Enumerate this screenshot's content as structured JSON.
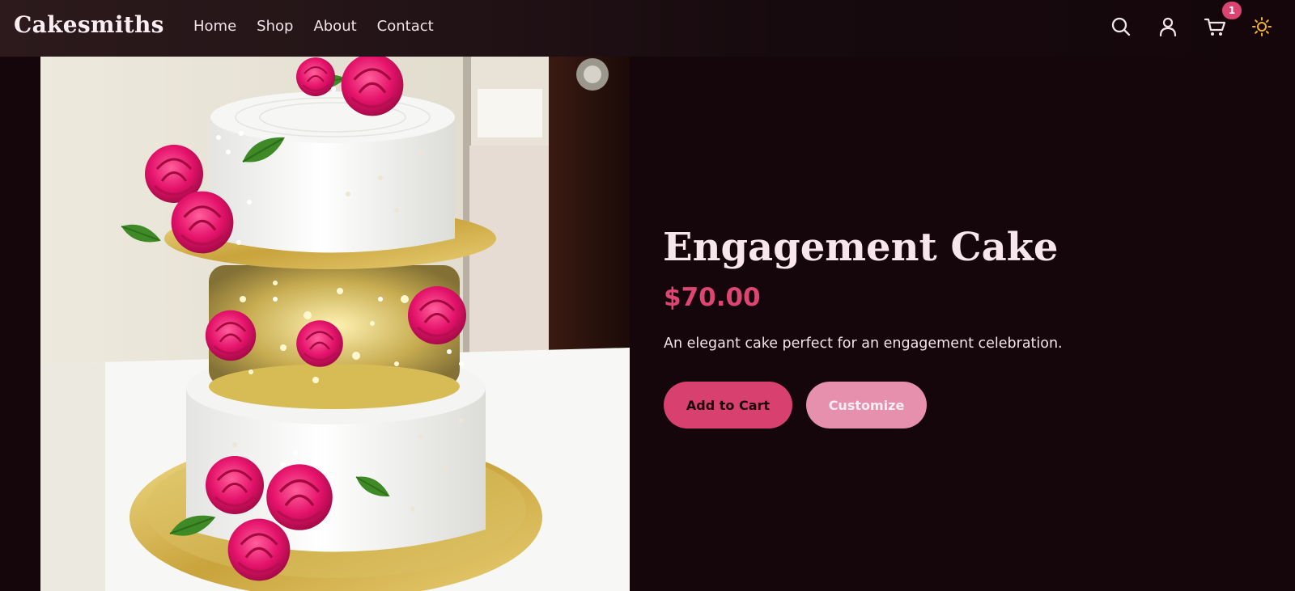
{
  "header": {
    "logo": "Cakesmiths",
    "nav": [
      {
        "label": "Home"
      },
      {
        "label": "Shop"
      },
      {
        "label": "About"
      },
      {
        "label": "Contact"
      }
    ],
    "icons": [
      "search-icon",
      "user-icon",
      "cart-icon",
      "sun-icon"
    ],
    "cart_count": "1"
  },
  "product": {
    "image_subject": "three-tier white cake with pink roses on a gold board",
    "title": "Engagement Cake",
    "price": "$70.00",
    "description": "An elegant cake perfect for an engagement celebration.",
    "add_to_cart_label": "Add to Cart",
    "customize_label": "Customize"
  },
  "colors": {
    "background": "#14060a",
    "accent": "#d84070",
    "accent_light": "#e690ad",
    "price": "#dd4673",
    "badge": "#d94470",
    "sun": "#f0b429"
  }
}
